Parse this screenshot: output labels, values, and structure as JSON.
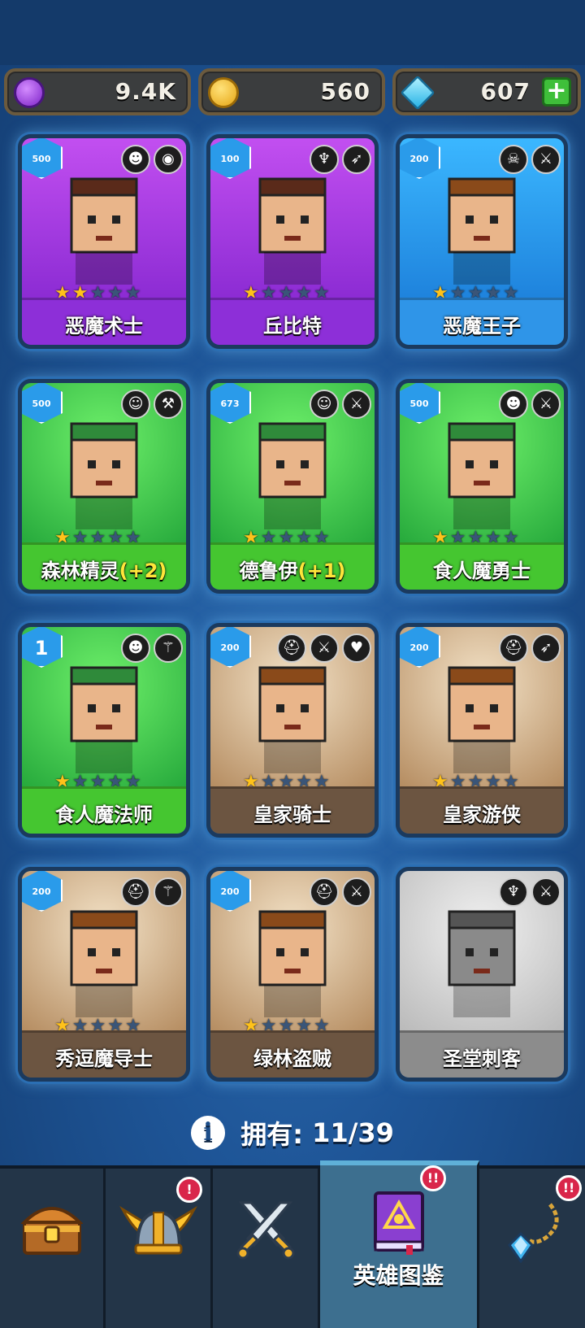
{
  "resources": {
    "gems_purple": "9.4K",
    "coins": "560",
    "diamonds": "607",
    "add_label": "+"
  },
  "heroes": [
    {
      "name": "恶魔术士",
      "bonus": "",
      "badge": "500",
      "stars": 2,
      "theme": "purple",
      "classes": [
        "demon-icon",
        "ogre-face-icon"
      ]
    },
    {
      "name": "丘比特",
      "bonus": "",
      "badge": "100",
      "stars": 1,
      "theme": "purple",
      "classes": [
        "wings-icon",
        "bow-icon"
      ]
    },
    {
      "name": "恶魔王子",
      "bonus": "",
      "badge": "200",
      "stars": 1,
      "theme": "blue",
      "classes": [
        "skull-horns-icon",
        "dagger-icon"
      ]
    },
    {
      "name": "森林精灵",
      "bonus": "(+2)",
      "badge": "500",
      "stars": 1,
      "theme": "green",
      "classes": [
        "elf-icon",
        "hammer-icon"
      ]
    },
    {
      "name": "德鲁伊",
      "bonus": "(+1)",
      "badge": "673",
      "stars": 1,
      "theme": "green",
      "classes": [
        "elf-icon",
        "sword-icon"
      ]
    },
    {
      "name": "食人魔勇士",
      "bonus": "",
      "badge": "500",
      "stars": 1,
      "theme": "green",
      "classes": [
        "ogre-icon",
        "sword-icon"
      ]
    },
    {
      "name": "食人魔法师",
      "bonus": "",
      "badge": "1",
      "stars": 1,
      "theme": "green",
      "classes": [
        "ogre-icon",
        "staff-icon"
      ]
    },
    {
      "name": "皇家骑士",
      "bonus": "",
      "badge": "200",
      "stars": 1,
      "theme": "brown",
      "classes": [
        "helmet-icon",
        "sword-icon",
        "heart-icon"
      ]
    },
    {
      "name": "皇家游侠",
      "bonus": "",
      "badge": "200",
      "stars": 1,
      "theme": "brown",
      "classes": [
        "helmet-icon",
        "bow-icon"
      ]
    },
    {
      "name": "秀逗魔导士",
      "bonus": "",
      "badge": "200",
      "stars": 1,
      "theme": "brown",
      "classes": [
        "helmet-icon",
        "staff-icon"
      ]
    },
    {
      "name": "绿林盗贼",
      "bonus": "",
      "badge": "200",
      "stars": 1,
      "theme": "brown",
      "classes": [
        "helmet-icon",
        "dagger-icon"
      ]
    },
    {
      "name": "圣堂刺客",
      "bonus": "",
      "badge": "",
      "stars": 0,
      "theme": "gray",
      "classes": [
        "wings-icon",
        "dagger-icon"
      ]
    }
  ],
  "owned": {
    "label": "拥有:",
    "count": "11/39"
  },
  "nav": {
    "tabs": [
      {
        "id": "chest",
        "label": "",
        "notif": ""
      },
      {
        "id": "heroes-helmet",
        "label": "",
        "notif": "!"
      },
      {
        "id": "battle",
        "label": "",
        "notif": ""
      },
      {
        "id": "codex",
        "label": "英雄图鉴",
        "notif": "!!"
      },
      {
        "id": "amulet",
        "label": "",
        "notif": "!!"
      }
    ],
    "active_tab": "codex"
  }
}
